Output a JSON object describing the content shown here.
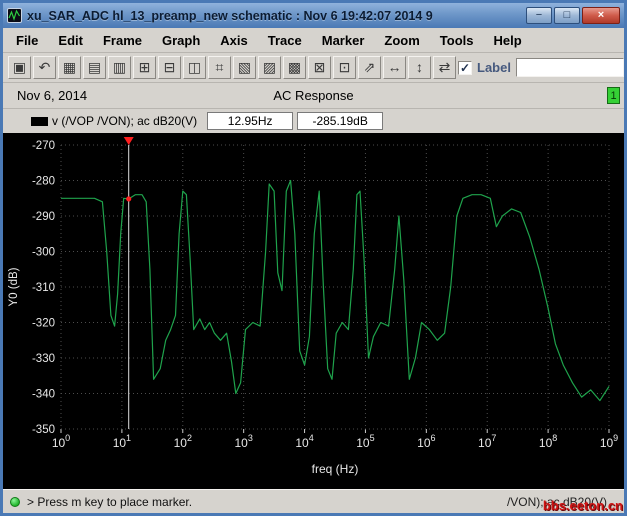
{
  "window": {
    "title": "xu_SAR_ADC hl_13_preamp_new schematic : Nov  6 19:42:07 2014 9",
    "buttons": {
      "minimize": "−",
      "maximize": "□",
      "close": "×"
    }
  },
  "menu": {
    "items": [
      "File",
      "Edit",
      "Frame",
      "Graph",
      "Axis",
      "Trace",
      "Marker",
      "Zoom",
      "Tools",
      "Help"
    ]
  },
  "toolbar": {
    "icons": [
      {
        "name": "print-icon",
        "glyph": "▣"
      },
      {
        "name": "undo-icon",
        "glyph": "↶"
      },
      {
        "name": "grid-icon",
        "glyph": "▦"
      },
      {
        "name": "strip-chart-icon",
        "glyph": "▤"
      },
      {
        "name": "overlay-chart-icon",
        "glyph": "▥"
      },
      {
        "name": "new-subwindow-icon",
        "glyph": "⊞"
      },
      {
        "name": "delete-subwindow-icon",
        "glyph": "⊟"
      },
      {
        "name": "copy-window-icon",
        "glyph": "◫"
      },
      {
        "name": "snap-grid-icon",
        "glyph": "⌗"
      },
      {
        "name": "slope-marker-icon",
        "glyph": "▧"
      },
      {
        "name": "trace-style-icon",
        "glyph": "▨"
      },
      {
        "name": "calculator-icon",
        "glyph": "▩"
      },
      {
        "name": "zoom-box-icon",
        "glyph": "⊠"
      },
      {
        "name": "zoom-center-icon",
        "glyph": "⊡"
      },
      {
        "name": "zoom-fit-icon",
        "glyph": "⇗"
      },
      {
        "name": "pan-horizontal-icon",
        "glyph": "↔"
      },
      {
        "name": "pan-vertical-icon",
        "glyph": "↕"
      },
      {
        "name": "swap-traces-icon",
        "glyph": "⇄"
      }
    ],
    "label_checkbox": {
      "label": "Label",
      "checked": true,
      "glyph": "✓"
    },
    "label_input_value": ""
  },
  "subheader": {
    "date": "Nov 6, 2014",
    "title": "AC Response",
    "window_number": "1"
  },
  "legend": {
    "trace_label": "v (/VOP /VON); ac dB20(V)",
    "marker_freq": "12.95Hz",
    "marker_value": "-285.19dB"
  },
  "statusbar": {
    "message": "> Press m key to place marker.",
    "right_text": "/VON); ac dB20(V)"
  },
  "watermark": "bbs.eeton.cn",
  "colors": {
    "trace": "#1fa34c",
    "grid": "#4d4d4d",
    "plot_bg": "#000000",
    "tick_text": "#e8e8e8",
    "marker": "#ff1f1f",
    "marker_line": "#e0e0e0",
    "window_number_green": "#35d035",
    "titlebar_blue": "#4a79b5"
  },
  "chart_data": {
    "type": "line",
    "title": "AC Response",
    "xlabel": "freq (Hz)",
    "ylabel": "Y0 (dB)",
    "x_scale": "log",
    "x_tick_exponents": [
      0,
      1,
      2,
      3,
      4,
      5,
      6,
      7,
      8,
      9
    ],
    "xlim_log10": [
      0,
      9
    ],
    "y_ticks": [
      -270,
      -280,
      -290,
      -300,
      -310,
      -320,
      -330,
      -340,
      -350
    ],
    "ylim": [
      -350,
      -270
    ],
    "grid": "dotted",
    "legend_position": "top-left",
    "marker": {
      "freq_hz": 12.95,
      "log10f": 1.112,
      "value_db": -285.19,
      "label_freq": "12.95Hz",
      "label_value": "-285.19dB"
    },
    "series": [
      {
        "name": "v (/VOP /VON); ac dB20(V)",
        "color": "#1fa34c",
        "points_log10f_db": [
          [
            0.0,
            -285
          ],
          [
            0.55,
            -285
          ],
          [
            0.68,
            -286
          ],
          [
            0.75,
            -300
          ],
          [
            0.82,
            -318
          ],
          [
            0.88,
            -321
          ],
          [
            0.93,
            -312
          ],
          [
            0.98,
            -295
          ],
          [
            1.03,
            -285
          ],
          [
            1.112,
            -285.19
          ],
          [
            1.22,
            -284
          ],
          [
            1.33,
            -284
          ],
          [
            1.4,
            -286
          ],
          [
            1.46,
            -305
          ],
          [
            1.52,
            -336
          ],
          [
            1.63,
            -333
          ],
          [
            1.72,
            -325
          ],
          [
            1.8,
            -322
          ],
          [
            1.88,
            -318
          ],
          [
            1.94,
            -295
          ],
          [
            2.0,
            -283
          ],
          [
            2.06,
            -284
          ],
          [
            2.12,
            -302
          ],
          [
            2.18,
            -322
          ],
          [
            2.28,
            -319
          ],
          [
            2.36,
            -322
          ],
          [
            2.44,
            -320
          ],
          [
            2.52,
            -323
          ],
          [
            2.62,
            -325
          ],
          [
            2.72,
            -323
          ],
          [
            2.8,
            -331
          ],
          [
            2.87,
            -340
          ],
          [
            2.95,
            -337
          ],
          [
            3.03,
            -322
          ],
          [
            3.15,
            -320
          ],
          [
            3.27,
            -321
          ],
          [
            3.36,
            -300
          ],
          [
            3.42,
            -281
          ],
          [
            3.5,
            -283
          ],
          [
            3.56,
            -306
          ],
          [
            3.63,
            -311
          ],
          [
            3.7,
            -283
          ],
          [
            3.77,
            -280
          ],
          [
            3.84,
            -295
          ],
          [
            3.92,
            -328
          ],
          [
            4.0,
            -332
          ],
          [
            4.08,
            -324
          ],
          [
            4.16,
            -295
          ],
          [
            4.24,
            -283
          ],
          [
            4.31,
            -310
          ],
          [
            4.38,
            -333
          ],
          [
            4.45,
            -336
          ],
          [
            4.52,
            -323
          ],
          [
            4.62,
            -320
          ],
          [
            4.72,
            -322
          ],
          [
            4.8,
            -305
          ],
          [
            4.86,
            -284
          ],
          [
            4.91,
            -283
          ],
          [
            4.98,
            -303
          ],
          [
            5.05,
            -330
          ],
          [
            5.13,
            -324
          ],
          [
            5.25,
            -320
          ],
          [
            5.38,
            -321
          ],
          [
            5.48,
            -305
          ],
          [
            5.55,
            -290
          ],
          [
            5.63,
            -308
          ],
          [
            5.72,
            -336
          ],
          [
            5.82,
            -330
          ],
          [
            5.92,
            -320
          ],
          [
            6.05,
            -322
          ],
          [
            6.18,
            -325
          ],
          [
            6.3,
            -323
          ],
          [
            6.4,
            -310
          ],
          [
            6.5,
            -290
          ],
          [
            6.6,
            -285
          ],
          [
            6.75,
            -284
          ],
          [
            6.9,
            -284
          ],
          [
            7.05,
            -285
          ],
          [
            7.15,
            -293
          ],
          [
            7.25,
            -290
          ],
          [
            7.4,
            -288
          ],
          [
            7.55,
            -289
          ],
          [
            7.7,
            -296
          ],
          [
            7.85,
            -305
          ],
          [
            8.0,
            -316
          ],
          [
            8.12,
            -326
          ],
          [
            8.25,
            -332
          ],
          [
            8.4,
            -337
          ],
          [
            8.55,
            -341
          ],
          [
            8.7,
            -339
          ],
          [
            8.85,
            -342
          ],
          [
            9.0,
            -338
          ]
        ]
      }
    ]
  }
}
